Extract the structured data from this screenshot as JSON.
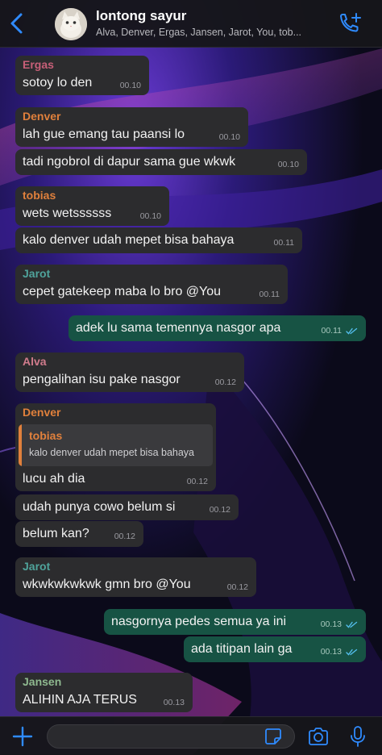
{
  "colors": {
    "accent": "#2f8bff",
    "incoming_bubble": "#2c2c2e",
    "outgoing_bubble": "#175344",
    "read_ticks": "#53bdeb"
  },
  "header": {
    "title": "lontong sayur",
    "subtitle": "Alva, Denver, Ergas, Jansen, Jarot, You, tob...",
    "back_icon": "chevron-left-icon",
    "call_icon": "add-call-icon"
  },
  "messages": [
    {
      "dir": "in",
      "sender": "Ergas",
      "sender_color": "#c75f78",
      "text": "sotoy lo den",
      "time": "00.10"
    },
    {
      "dir": "in",
      "sender": "Denver",
      "sender_color": "#e0803c",
      "text": "lah gue emang tau paansi lo",
      "time": "00.10"
    },
    {
      "dir": "in",
      "text": "tadi ngobrol di dapur sama gue wkwk",
      "time": "00.10"
    },
    {
      "dir": "in",
      "sender": "tobias",
      "sender_color": "#e0803c",
      "text": "wets wetssssss",
      "time": "00.10"
    },
    {
      "dir": "in",
      "text": "kalo denver udah mepet bisa bahaya",
      "time": "00.11"
    },
    {
      "dir": "in",
      "sender": "Jarot",
      "sender_color": "#4fa39b",
      "text": "cepet gatekeep maba lo bro @You",
      "time": "00.11"
    },
    {
      "dir": "out",
      "text": "adek lu sama temennya nasgor apa",
      "time": "00.11"
    },
    {
      "dir": "in",
      "sender": "Alva",
      "sender_color": "#d07b8c",
      "text": "pengalihan isu pake nasgor",
      "time": "00.12"
    },
    {
      "dir": "in",
      "sender": "Denver",
      "sender_color": "#e0803c",
      "quote_name": "tobias",
      "quote_text": "kalo denver udah mepet bisa bahaya",
      "text": "lucu ah dia",
      "time": "00.12"
    },
    {
      "dir": "in",
      "text": "udah punya cowo belum si",
      "time": "00.12"
    },
    {
      "dir": "in",
      "text": "belum kan?",
      "time": "00.12"
    },
    {
      "dir": "in",
      "sender": "Jarot",
      "sender_color": "#4fa39b",
      "text": "wkwkwkwkwk gmn bro @You",
      "time": "00.12"
    },
    {
      "dir": "out",
      "text": "nasgornya pedes semua ya ini",
      "time": "00.13"
    },
    {
      "dir": "out",
      "text": "ada titipan lain ga",
      "time": "00.13"
    },
    {
      "dir": "in",
      "sender": "Jansen",
      "sender_color": "#8fb98f",
      "text": "ALIHIN AJA TERUS",
      "time": "00.13"
    }
  ],
  "input_bar": {
    "icons": [
      "plus-icon",
      "sticker-icon",
      "camera-icon",
      "microphone-icon"
    ]
  }
}
